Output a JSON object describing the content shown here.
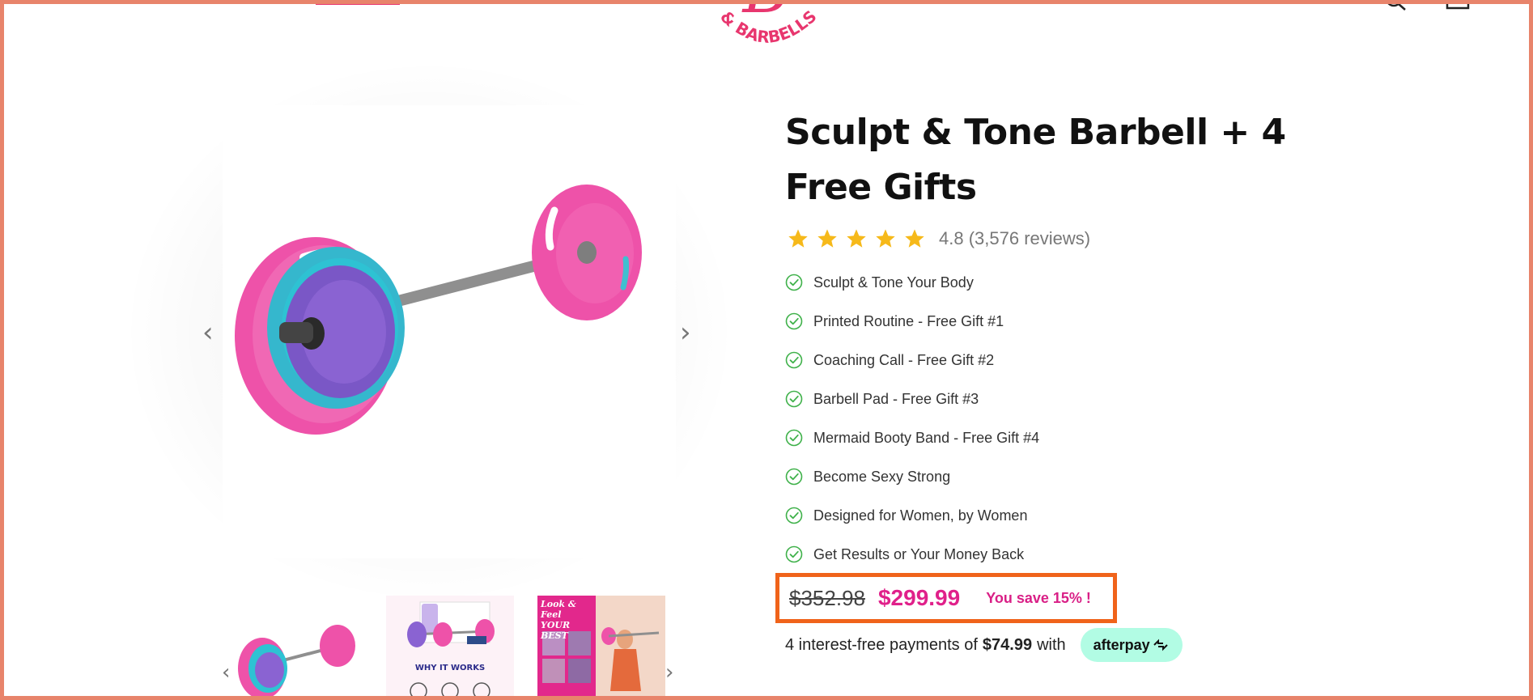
{
  "header": {
    "logo_text": "& BARBELLS"
  },
  "gallery": {
    "main_image_alt": "Pink barbell with plates",
    "thumbnails": [
      {
        "label": ""
      },
      {
        "label": "WHY IT WORKS"
      },
      {
        "label": "Look & Feel YOUR BEST"
      }
    ]
  },
  "product": {
    "title": "Sculpt & Tone Barbell + 4 Free Gifts",
    "rating_value": 4.8,
    "rating_text": "4.8 (3,576 reviews)",
    "features": [
      "Sculpt & Tone Your Body",
      "Printed Routine - Free Gift #1",
      "Coaching Call - Free Gift #2",
      "Barbell Pad - Free Gift #3",
      "Mermaid Booty Band - Free Gift #4",
      "Become Sexy Strong",
      "Designed for Women, by Women",
      "Get Results or Your Money Back"
    ],
    "old_price": "$352.98",
    "new_price": "$299.99",
    "save_text": "You save 15% !",
    "afterpay_prefix": "4 interest-free payments of",
    "afterpay_amount": "$74.99",
    "afterpay_suffix": "with",
    "afterpay_label": "afterpay"
  },
  "colors": {
    "brand_pink": "#e8366e",
    "price_pink": "#e0208a",
    "star": "#f6b91a",
    "check": "#3fb14a",
    "highlight_border": "#f0631a",
    "afterpay_mint": "#b2fce4"
  }
}
